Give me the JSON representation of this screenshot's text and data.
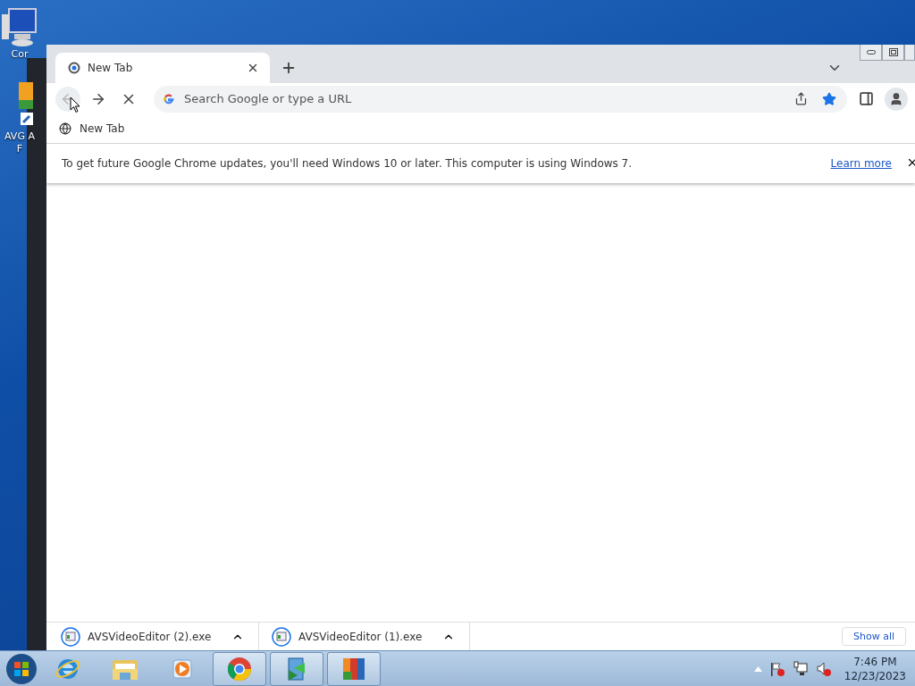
{
  "desktop_icons": [
    {
      "lines": [
        "Cor"
      ]
    },
    {
      "lines": [
        "AVG A",
        "F"
      ]
    }
  ],
  "browser": {
    "tabs": [
      {
        "title": "New Tab",
        "selected": true
      }
    ],
    "toolbar": {
      "back_disabled": true,
      "omnibox_placeholder": "Search Google or type a URL",
      "bookmarked": true
    },
    "bookmarks": [
      {
        "label": "New Tab"
      }
    ],
    "infobar": {
      "message": "To get future Google Chrome updates, you'll need Windows 10 or later. This computer is using Windows 7.",
      "link": "Learn more"
    },
    "downloads": [
      {
        "name": "AVSVideoEditor (2).exe"
      },
      {
        "name": "AVSVideoEditor (1).exe"
      }
    ],
    "show_all": "Show all"
  },
  "taskbar": {
    "apps": [
      {
        "kind": "ie",
        "running": false
      },
      {
        "kind": "folder",
        "running": false
      },
      {
        "kind": "media",
        "running": false
      },
      {
        "kind": "chrome",
        "running": true
      },
      {
        "kind": "avs",
        "running": true
      },
      {
        "kind": "avg",
        "running": true
      }
    ],
    "time": "7:46 PM",
    "date": "12/23/2023"
  }
}
